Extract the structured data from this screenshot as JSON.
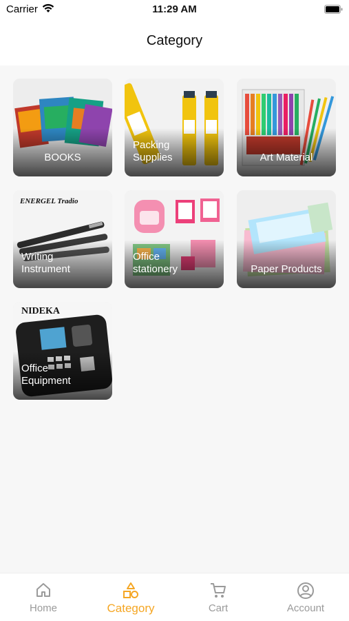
{
  "status_bar": {
    "carrier": "Carrier",
    "time": "11:29 AM"
  },
  "nav": {
    "title": "Category"
  },
  "categories": [
    {
      "label": "BOOKS"
    },
    {
      "label": "Packing\nSupplies"
    },
    {
      "label": "Art Material"
    },
    {
      "label": "Writing\nInstrument",
      "brand_text": "ENERGEL Tradio"
    },
    {
      "label": "Office\nstationery"
    },
    {
      "label": "Paper Products"
    },
    {
      "label": "Office\nEquipment",
      "brand_text": "NIDEKA"
    }
  ],
  "tabs": [
    {
      "label": "Home",
      "icon": "home-icon",
      "active": false
    },
    {
      "label": "Category",
      "icon": "shapes-icon",
      "active": true
    },
    {
      "label": "Cart",
      "icon": "cart-icon",
      "active": false
    },
    {
      "label": "Account",
      "icon": "account-icon",
      "active": false
    }
  ],
  "colors": {
    "accent": "#f5a623",
    "inactive": "#9a9a9a"
  }
}
